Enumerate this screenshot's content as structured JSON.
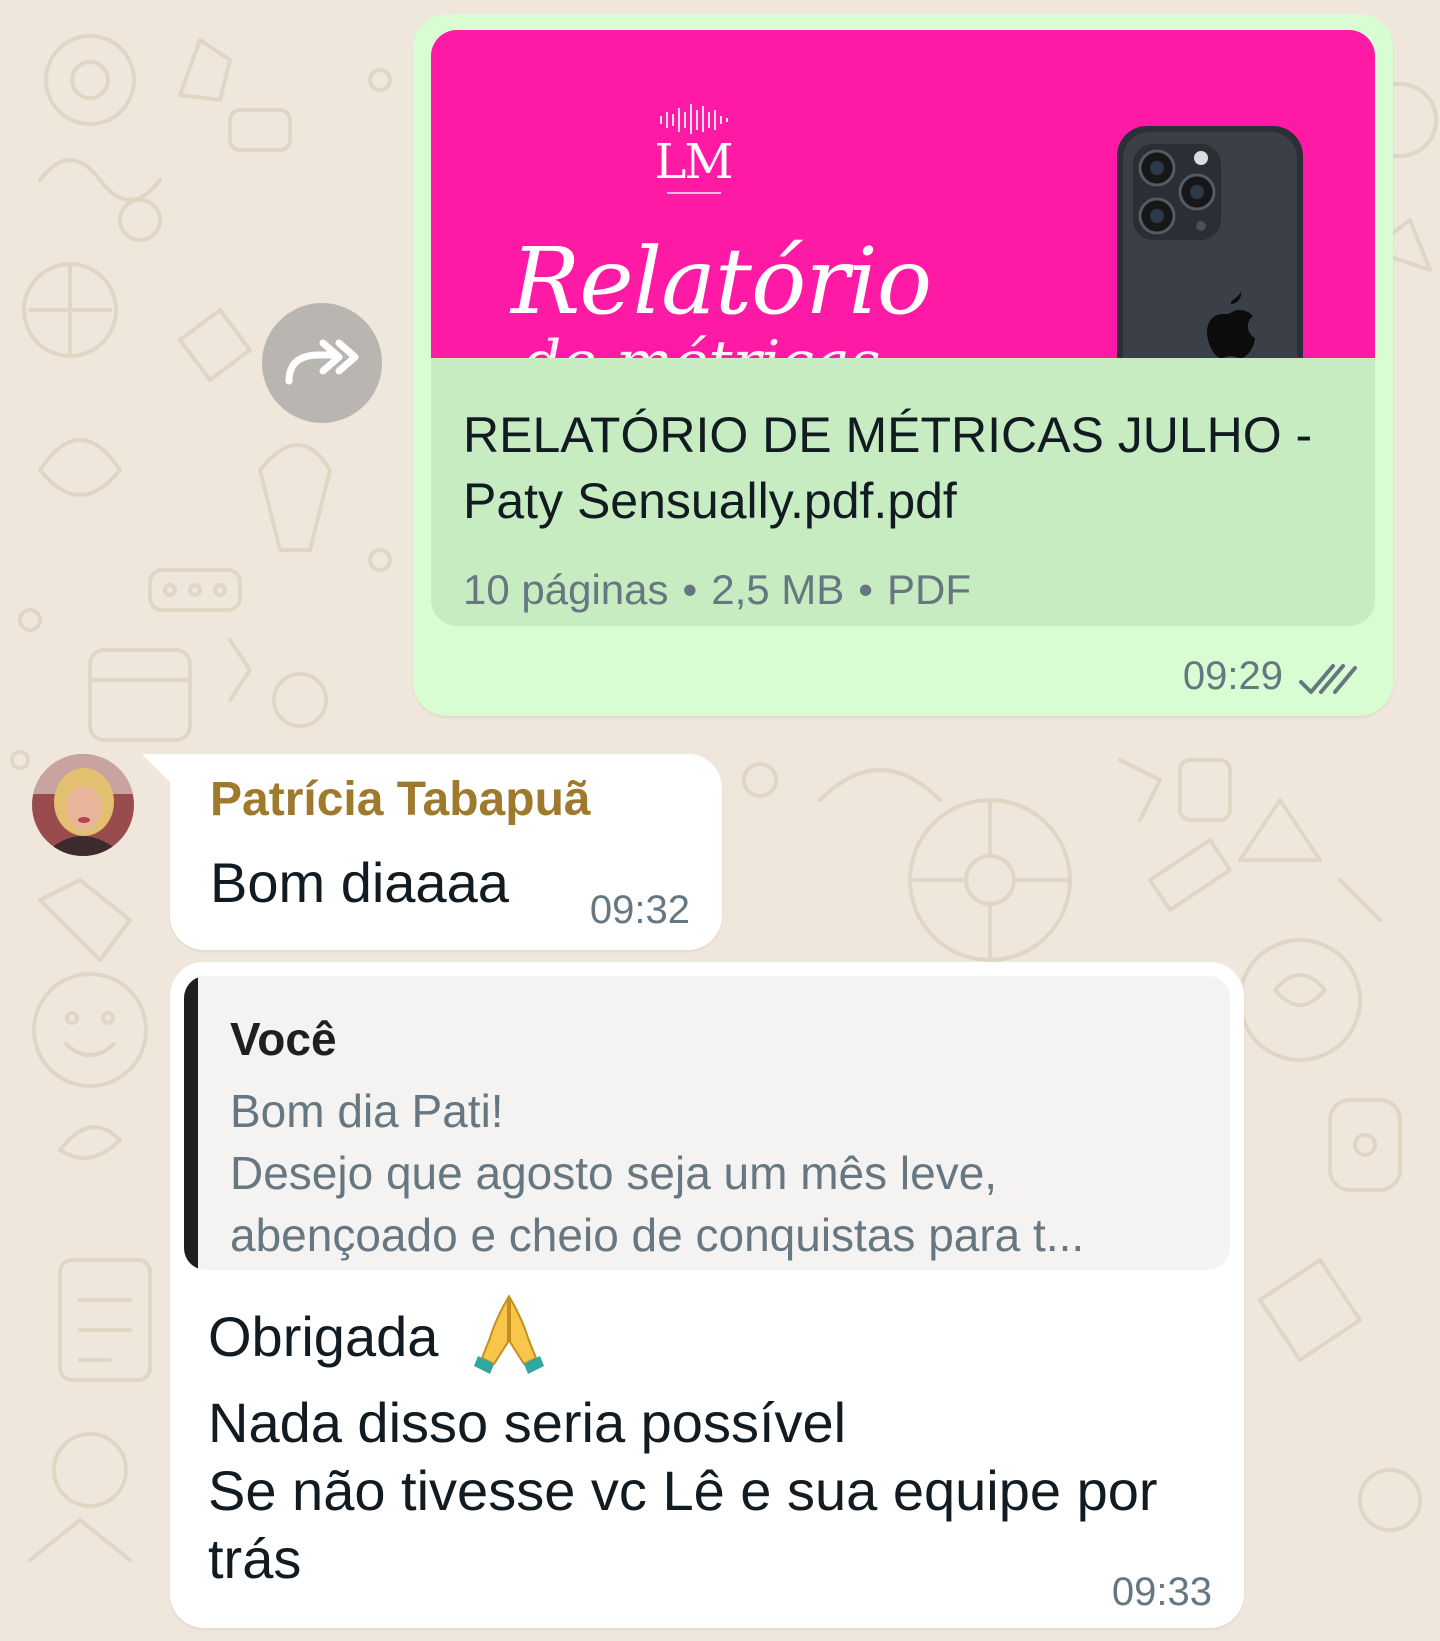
{
  "outgoing_document": {
    "thumbnail": {
      "logo_text": "LM",
      "title": "Relatório",
      "subtitle": "de métricas"
    },
    "file_name": "RELATÓRIO DE MÉTRICAS JULHO - Paty Sensually.pdf.pdf",
    "pages": "10 páginas",
    "size": "2,5 MB",
    "type": "PDF",
    "separator": "•",
    "time": "09:29",
    "status_icon": "double-check-icon"
  },
  "forward_button": {
    "icon": "forward-icon"
  },
  "incoming_1": {
    "sender": "Patrícia Tabapuã",
    "text": "Bom diaaaa",
    "time": "09:32"
  },
  "incoming_2": {
    "quote": {
      "author": "Você",
      "lines": [
        "Bom dia Pati!",
        "Desejo que agosto seja um mês leve,",
        "abençoado e cheio de conquistas para t..."
      ]
    },
    "lines": [
      "Obrigada",
      "Nada disso seria possível",
      "Se não tivesse vc Lê e sua equipe por",
      "trás"
    ],
    "emoji": "folded-hands-icon",
    "time": "09:33"
  },
  "colors": {
    "wallpaper": "#efe7dc",
    "outgoing_bubble": "#d9fdd3",
    "document_card": "#c8ecc1",
    "thumbnail_pink": "#ff1aa6",
    "sender_name": "#a07a2c",
    "meta_text": "#667781"
  }
}
